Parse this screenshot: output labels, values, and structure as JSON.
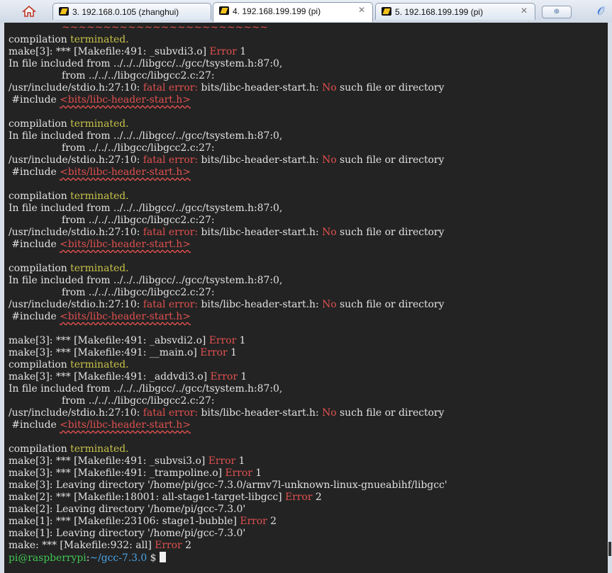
{
  "tabs": [
    {
      "label": "3. 192.168.0.105 (zhanghui)",
      "active": false
    },
    {
      "label": "4. 192.168.199.199 (pi)",
      "active": true
    },
    {
      "label": "5. 192.168.199.199 (pi)",
      "active": false
    }
  ],
  "tab_close_glyph": "✕",
  "terminal": {
    "lines": [
      [
        {
          "t": "                 ~~~~~~~~~~~~~~~~~~~~~~~~~",
          "c": "squig"
        }
      ],
      [
        {
          "t": "compilation "
        },
        {
          "t": "terminated.",
          "c": "y"
        }
      ],
      [
        {
          "t": "make[3]: *** [Makefile:491: _subvdi3.o] "
        },
        {
          "t": "Error",
          "c": "r"
        },
        {
          "t": " 1"
        }
      ],
      [
        {
          "t": "In file included from ../../../libgcc/../gcc/tsystem.h:87:0,"
        }
      ],
      [
        {
          "t": "                 from ../../../libgcc/libgcc2.c:27:"
        }
      ],
      [
        {
          "t": "/usr/include/stdio.h:27:10: "
        },
        {
          "t": "fatal error:",
          "c": "r"
        },
        {
          "t": " bits/libc-header-start.h: "
        },
        {
          "t": "No",
          "c": "r"
        },
        {
          "t": " such file or directory"
        }
      ],
      [
        {
          "t": " #include "
        },
        {
          "t": "<bits/libc-header-start.h>",
          "c": "p"
        }
      ],
      [
        {
          "t": ""
        }
      ],
      [
        {
          "t": "compilation "
        },
        {
          "t": "terminated.",
          "c": "y"
        }
      ],
      [
        {
          "t": "In file included from ../../../libgcc/../gcc/tsystem.h:87:0,"
        }
      ],
      [
        {
          "t": "                 from ../../../libgcc/libgcc2.c:27:"
        }
      ],
      [
        {
          "t": "/usr/include/stdio.h:27:10: "
        },
        {
          "t": "fatal error:",
          "c": "r"
        },
        {
          "t": " bits/libc-header-start.h: "
        },
        {
          "t": "No",
          "c": "r"
        },
        {
          "t": " such file or directory"
        }
      ],
      [
        {
          "t": " #include "
        },
        {
          "t": "<bits/libc-header-start.h>",
          "c": "p"
        }
      ],
      [
        {
          "t": ""
        }
      ],
      [
        {
          "t": "compilation "
        },
        {
          "t": "terminated.",
          "c": "y"
        }
      ],
      [
        {
          "t": "In file included from ../../../libgcc/../gcc/tsystem.h:87:0,"
        }
      ],
      [
        {
          "t": "                 from ../../../libgcc/libgcc2.c:27:"
        }
      ],
      [
        {
          "t": "/usr/include/stdio.h:27:10: "
        },
        {
          "t": "fatal error:",
          "c": "r"
        },
        {
          "t": " bits/libc-header-start.h: "
        },
        {
          "t": "No",
          "c": "r"
        },
        {
          "t": " such file or directory"
        }
      ],
      [
        {
          "t": " #include "
        },
        {
          "t": "<bits/libc-header-start.h>",
          "c": "p"
        }
      ],
      [
        {
          "t": ""
        }
      ],
      [
        {
          "t": "compilation "
        },
        {
          "t": "terminated.",
          "c": "y"
        }
      ],
      [
        {
          "t": "In file included from ../../../libgcc/../gcc/tsystem.h:87:0,"
        }
      ],
      [
        {
          "t": "                 from ../../../libgcc/libgcc2.c:27:"
        }
      ],
      [
        {
          "t": "/usr/include/stdio.h:27:10: "
        },
        {
          "t": "fatal error:",
          "c": "r"
        },
        {
          "t": " bits/libc-header-start.h: "
        },
        {
          "t": "No",
          "c": "r"
        },
        {
          "t": " such file or directory"
        }
      ],
      [
        {
          "t": " #include "
        },
        {
          "t": "<bits/libc-header-start.h>",
          "c": "p"
        }
      ],
      [
        {
          "t": ""
        }
      ],
      [
        {
          "t": "make[3]: *** [Makefile:491: _absvdi2.o] "
        },
        {
          "t": "Error",
          "c": "r"
        },
        {
          "t": " 1"
        }
      ],
      [
        {
          "t": "make[3]: *** [Makefile:491: __main.o] "
        },
        {
          "t": "Error",
          "c": "r"
        },
        {
          "t": " 1"
        }
      ],
      [
        {
          "t": "compilation "
        },
        {
          "t": "terminated.",
          "c": "y"
        }
      ],
      [
        {
          "t": "make[3]: *** [Makefile:491: _addvdi3.o] "
        },
        {
          "t": "Error",
          "c": "r"
        },
        {
          "t": " 1"
        }
      ],
      [
        {
          "t": "In file included from ../../../libgcc/../gcc/tsystem.h:87:0,"
        }
      ],
      [
        {
          "t": "                 from ../../../libgcc/libgcc2.c:27:"
        }
      ],
      [
        {
          "t": "/usr/include/stdio.h:27:10: "
        },
        {
          "t": "fatal error:",
          "c": "r"
        },
        {
          "t": " bits/libc-header-start.h: "
        },
        {
          "t": "No",
          "c": "r"
        },
        {
          "t": " such file or directory"
        }
      ],
      [
        {
          "t": " #include "
        },
        {
          "t": "<bits/libc-header-start.h>",
          "c": "p"
        }
      ],
      [
        {
          "t": ""
        }
      ],
      [
        {
          "t": "compilation "
        },
        {
          "t": "terminated.",
          "c": "y"
        }
      ],
      [
        {
          "t": "make[3]: *** [Makefile:491: _subvsi3.o] "
        },
        {
          "t": "Error",
          "c": "r"
        },
        {
          "t": " 1"
        }
      ],
      [
        {
          "t": "make[3]: *** [Makefile:491: _trampoline.o] "
        },
        {
          "t": "Error",
          "c": "r"
        },
        {
          "t": " 1"
        }
      ],
      [
        {
          "t": "make[3]: Leaving directory '/home/pi/gcc-7.3.0/armv7l-unknown-linux-gnueabihf/libgcc'"
        }
      ],
      [
        {
          "t": "make[2]: *** [Makefile:18001: all-stage1-target-libgcc] "
        },
        {
          "t": "Error",
          "c": "r"
        },
        {
          "t": " 2"
        }
      ],
      [
        {
          "t": "make[2]: Leaving directory '/home/pi/gcc-7.3.0'"
        }
      ],
      [
        {
          "t": "make[1]: *** [Makefile:23106: stage1-bubble] "
        },
        {
          "t": "Error",
          "c": "r"
        },
        {
          "t": " 2"
        }
      ],
      [
        {
          "t": "make[1]: Leaving directory '/home/pi/gcc-7.3.0'"
        }
      ],
      [
        {
          "t": "make: *** [Makefile:932: all] "
        },
        {
          "t": "Error",
          "c": "r"
        },
        {
          "t": " 2"
        }
      ]
    ],
    "prompt": {
      "user_host": "pi@raspberrypi",
      "separator": ":",
      "path": "~/gcc-7.3.0",
      "symbol": " $ "
    }
  },
  "icons": {
    "home": "home-icon",
    "tab": "putty-terminal-icon",
    "new_tab": "new-tab-icon",
    "attach": "paperclip-icon"
  },
  "colors": {
    "background": "#232323",
    "text": "#e2e2e2",
    "error_red": "#e0504f",
    "warning_yellow": "#c7c24a",
    "prompt_green": "#42c653",
    "path_blue": "#4aa6e8"
  }
}
